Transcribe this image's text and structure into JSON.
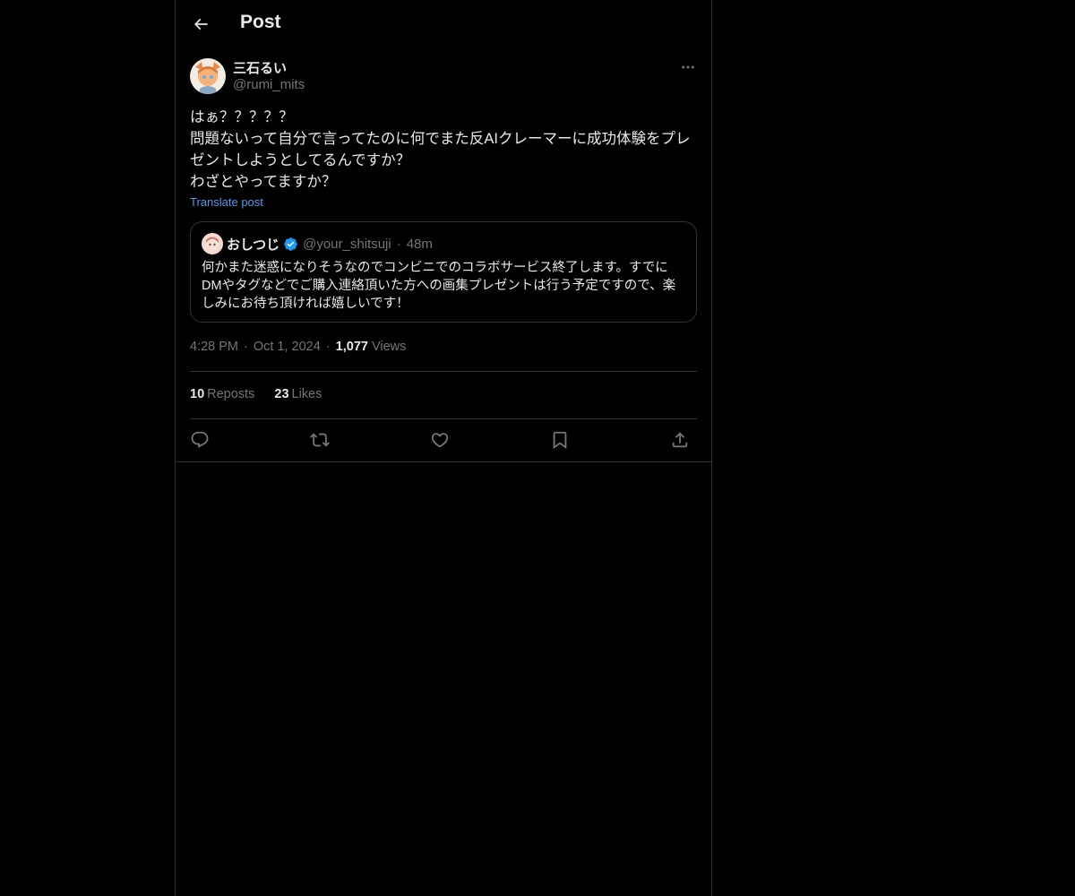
{
  "header": {
    "title": "Post"
  },
  "author": {
    "name": "三石るい",
    "handle": "@rumi_mits"
  },
  "post": {
    "text": "はぁ？？？？？\n問題ないって自分で言ってたのに何でまた反AIクレーマーに成功体験をプレゼントしようとしてるんですか？\nわざとやってますか？",
    "translate_label": "Translate post"
  },
  "quote": {
    "name": "おしつじ",
    "handle": "@your_shitsuji",
    "separator": "·",
    "time": "48m",
    "text": "何かまた迷惑になりそうなのでコンビニでのコラボサービス終了します。すでにDMやタグなどでご購入連絡頂いた方への画集プレゼントは行う予定ですので、楽しみにお待ち頂ければ嬉しいです！",
    "verified": true
  },
  "meta": {
    "time": "4:28 PM",
    "separator": "·",
    "date": "Oct 1, 2024",
    "views_count": "1,077",
    "views_label": "Views"
  },
  "stats": {
    "reposts_count": "10",
    "reposts_label": "Reposts",
    "likes_count": "23",
    "likes_label": "Likes"
  },
  "colors": {
    "background": "#000000",
    "text": "#e7e9ea",
    "muted": "#71767b",
    "border": "#2f3336",
    "link": "#4e9be8",
    "verified": "#1d9bf0"
  },
  "icons": [
    "back-arrow-icon",
    "more-icon",
    "verified-badge-icon",
    "reply-icon",
    "repost-icon",
    "like-icon",
    "bookmark-icon",
    "share-icon"
  ]
}
